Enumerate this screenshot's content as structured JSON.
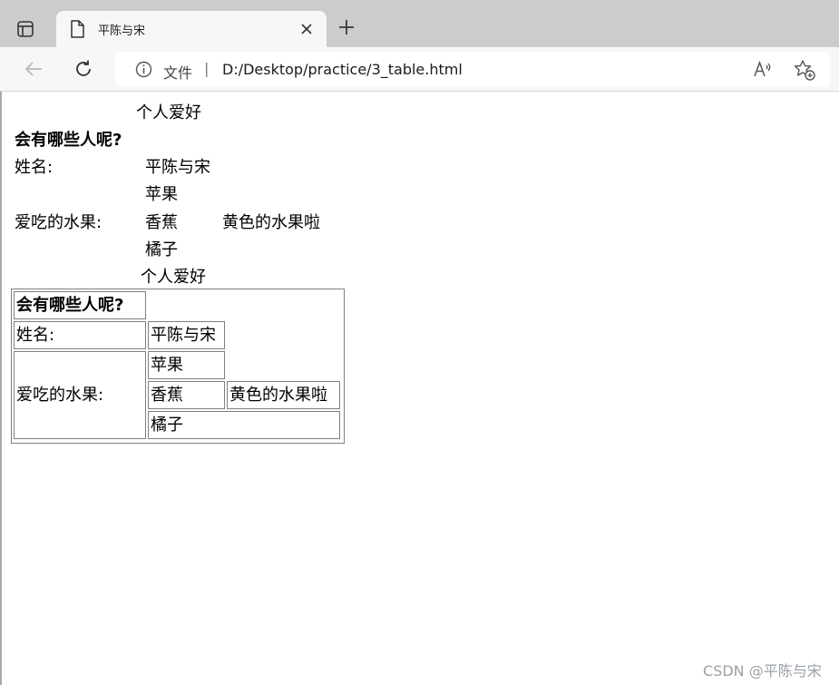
{
  "browser": {
    "tab": {
      "title": "平陈与宋"
    },
    "address": {
      "label": "文件",
      "separator": "|",
      "url": "D:/Desktop/practice/3_table.html"
    }
  },
  "page": {
    "plain_table": {
      "caption": "个人爱好",
      "header": "会有哪些人呢?",
      "name_label": "姓名:",
      "name_value": "平陈与宋",
      "fruit_label": "爱吃的水果:",
      "fruits": [
        "苹果",
        "香蕉",
        "橘子"
      ],
      "banana_note": "黄色的水果啦"
    },
    "bordered_table": {
      "caption": "个人爱好",
      "header": "会有哪些人呢?",
      "name_label": "姓名:",
      "name_value": "平陈与宋",
      "fruit_label": "爱吃的水果:",
      "fruits": [
        "苹果",
        "香蕉",
        "橘子"
      ],
      "banana_note": "黄色的水果啦"
    }
  },
  "watermark": "CSDN @平陈与宋",
  "colors": {
    "tabstrip": "#cccccc",
    "toolbar": "#f7f7f7",
    "border": "#808080"
  }
}
